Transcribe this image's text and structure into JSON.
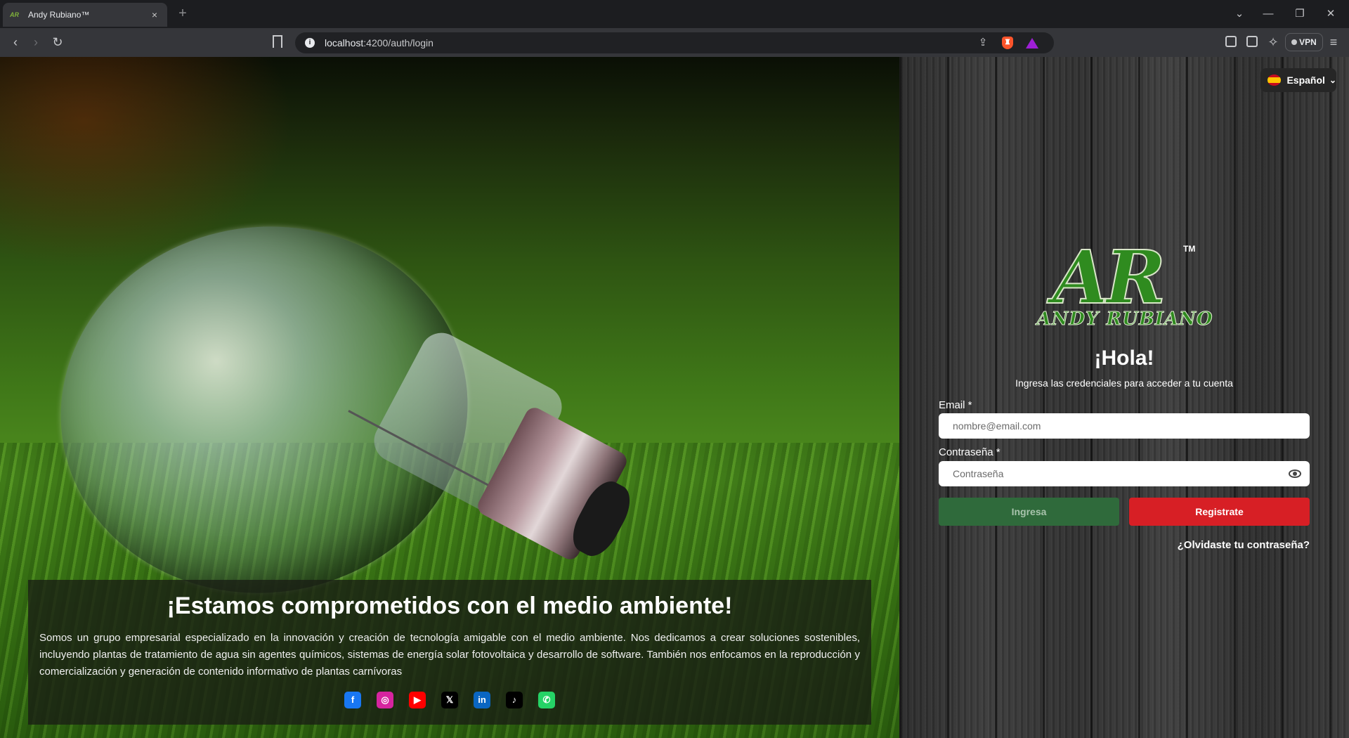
{
  "browser": {
    "tab_title": "Andy Rubiano™",
    "tab_favicon": "AR",
    "tab_close": "×",
    "new_tab": "+",
    "url_host": "localhost",
    "url_path": ":4200/auth/login",
    "vpn_label": "VPN",
    "icons": [
      "back-icon",
      "forward-icon",
      "reload-icon",
      "bookmark-icon",
      "site-info-icon",
      "share-icon",
      "brave-shields-icon",
      "brave-rewards-icon",
      "sidebar-icon",
      "wallet-icon",
      "leo-ai-icon",
      "menu-icon"
    ]
  },
  "hero": {
    "title": "¡Estamos comprometidos con el medio ambiente!",
    "text": "Somos un grupo empresarial especializado en la innovación y creación de tecnología amigable con el medio ambiente. Nos dedicamos a crear soluciones sostenibles, incluyendo plantas de tratamiento de agua sin agentes químicos, sistemas de energía solar fotovoltaica y desarrollo de software. También nos enfocamos en la reproducción y comercialización y generación de contenido informativo de plantas carnívoras",
    "socials": [
      {
        "name": "facebook-icon",
        "glyph": "f",
        "color": "#1877f2"
      },
      {
        "name": "instagram-icon",
        "glyph": "◎",
        "color": "#d6249f"
      },
      {
        "name": "youtube-icon",
        "glyph": "▶",
        "color": "#ff0000"
      },
      {
        "name": "x-icon",
        "glyph": "𝕏",
        "color": "#000000"
      },
      {
        "name": "linkedin-icon",
        "glyph": "in",
        "color": "#0a66c2"
      },
      {
        "name": "tiktok-icon",
        "glyph": "♪",
        "color": "#000000"
      },
      {
        "name": "whatsapp-icon",
        "glyph": "✆",
        "color": "#25d366"
      }
    ]
  },
  "login": {
    "language": "Español",
    "logo_letters": "AR",
    "logo_tm": "TM",
    "logo_name": "ANDY RUBIANO",
    "greeting": "¡Hola!",
    "subtitle": "Ingresa las credenciales para acceder a tu cuenta",
    "email_label": "Email *",
    "email_placeholder": "nombre@email.com",
    "password_label": "Contraseña *",
    "password_placeholder": "Contraseña",
    "login_button": "Ingresa",
    "register_button": "Registrate",
    "forgot_link": "¿Olvidaste tu contraseña?",
    "colors": {
      "login_button": "#2f6a3b",
      "register_button": "#d71f25"
    }
  }
}
